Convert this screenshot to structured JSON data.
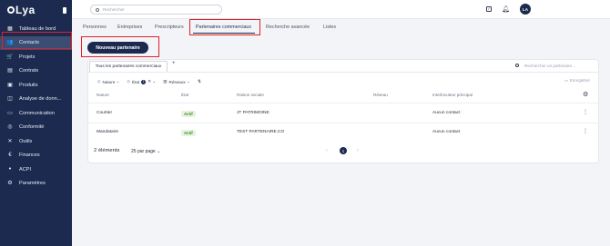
{
  "app": {
    "logo_text": "Lya"
  },
  "sidebar": {
    "items": [
      {
        "label": "Tableau de bord",
        "icon": "dashboard-icon"
      },
      {
        "label": "Contacts",
        "icon": "contacts-icon"
      },
      {
        "label": "Projets",
        "icon": "cart-icon"
      },
      {
        "label": "Contrats",
        "icon": "document-icon"
      },
      {
        "label": "Produits",
        "icon": "box-icon"
      },
      {
        "label": "Analyse de donn...",
        "icon": "chart-icon"
      },
      {
        "label": "Communication",
        "icon": "message-icon"
      },
      {
        "label": "Conformité",
        "icon": "check-circle-icon"
      },
      {
        "label": "Outils",
        "icon": "tools-icon"
      },
      {
        "label": "Finances",
        "icon": "euro-icon"
      },
      {
        "label": "ACPI",
        "icon": "group-icon"
      },
      {
        "label": "Paramètres",
        "icon": "gear-icon"
      }
    ],
    "active_index": 1
  },
  "topbar": {
    "search_placeholder": "Rechercher",
    "avatar_initials": "LA"
  },
  "tabs": [
    {
      "label": "Personnes"
    },
    {
      "label": "Entreprises"
    },
    {
      "label": "Prescripteurs"
    },
    {
      "label": "Partenaires commerciaux"
    },
    {
      "label": "Recherche avancée"
    },
    {
      "label": "Listes"
    }
  ],
  "active_tab_index": 3,
  "new_button_label": "Nouveau partenaire",
  "subtab": {
    "label": "Tous les partenaires commerciaux",
    "add": "+"
  },
  "card_search_placeholder": "Rechercher un partenaire...",
  "filters": {
    "nature": "Nature",
    "etat": "État",
    "etat_count": "1",
    "reseaux": "Réseaux",
    "save": "Enregistrer"
  },
  "table": {
    "columns": [
      "Nature",
      "État",
      "Raison sociale",
      "Réseau",
      "Interlocuteur principal"
    ],
    "rows": [
      {
        "nature": "Courtier",
        "etat": "Actif",
        "raison_sociale": "JT PATRIMOINE",
        "reseau": "",
        "interlocuteur": "Aucun contact"
      },
      {
        "nature": "Mandataire",
        "etat": "Actif",
        "raison_sociale": "TEST PARTENAIRE.CO",
        "reseau": "",
        "interlocuteur": "Aucun contact"
      }
    ]
  },
  "footer": {
    "count": "2 éléments",
    "per_page": "25 par page",
    "current_page": "1"
  },
  "colors": {
    "sidebar_bg": "#1b2a4e",
    "accent": "#1b2a4e",
    "highlight": "#e0202a",
    "status_active": "#3f8a2a"
  }
}
